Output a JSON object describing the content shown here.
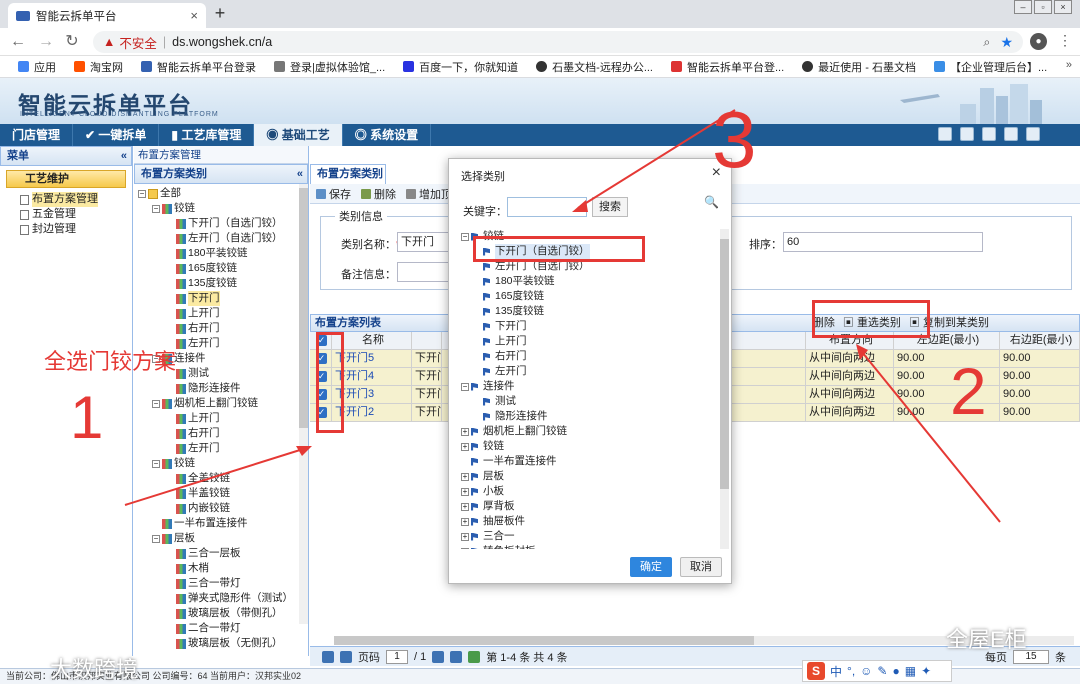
{
  "browser": {
    "tab_title": "智能云拆单平台",
    "tab_close": "×",
    "new_tab": "+",
    "insecure_label": "不安全",
    "url": "ds.wongshek.cn/a",
    "bookmarks": [
      "应用",
      "淘宝网",
      "智能云拆单平台登录",
      "登录|虚拟体验馆_...",
      "百度一下，你就知道",
      "石墨文档-远程办公...",
      "智能云拆单平台登...",
      "最近使用 - 石墨文档",
      "【企业管理后台】..."
    ],
    "bookmark_more": "»"
  },
  "app": {
    "title": "智能云拆单平台",
    "subtitle": "INTELLIGENT CLOUD DISMANTLING PLATFORM",
    "nav": [
      "门店管理",
      "一键拆单",
      "工艺库管理",
      "基础工艺",
      "系统设置"
    ],
    "active_nav": 3
  },
  "leftmenu": {
    "title": "菜单",
    "section": "工艺维护",
    "items": [
      "布置方案管理",
      "五金管理",
      "封边管理"
    ]
  },
  "treepanel": {
    "breadcrumb": "布置方案管理",
    "title": "布置方案类别",
    "nodes": [
      {
        "label": "全部",
        "level": 0,
        "kind": "folder",
        "pm": "−"
      },
      {
        "label": "铰链",
        "level": 1,
        "kind": "bar",
        "pm": "−"
      },
      {
        "label": "下开门（自选门铰）",
        "level": 2,
        "kind": "bar"
      },
      {
        "label": "左开门（自选门铰）",
        "level": 2,
        "kind": "bar"
      },
      {
        "label": "180平装铰链",
        "level": 2,
        "kind": "bar"
      },
      {
        "label": "165度铰链",
        "level": 2,
        "kind": "bar"
      },
      {
        "label": "135度铰链",
        "level": 2,
        "kind": "bar"
      },
      {
        "label": "下开门",
        "level": 2,
        "kind": "bar",
        "hl": true
      },
      {
        "label": "上开门",
        "level": 2,
        "kind": "bar"
      },
      {
        "label": "右开门",
        "level": 2,
        "kind": "bar"
      },
      {
        "label": "左开门",
        "level": 2,
        "kind": "bar"
      },
      {
        "label": "连接件",
        "level": 1,
        "kind": "bar",
        "pm": "−"
      },
      {
        "label": "测试",
        "level": 2,
        "kind": "bar"
      },
      {
        "label": "隐形连接件",
        "level": 2,
        "kind": "bar"
      },
      {
        "label": "烟机柜上翻门铰链",
        "level": 1,
        "kind": "bar",
        "pm": "−"
      },
      {
        "label": "上开门",
        "level": 2,
        "kind": "bar"
      },
      {
        "label": "右开门",
        "level": 2,
        "kind": "bar"
      },
      {
        "label": "左开门",
        "level": 2,
        "kind": "bar"
      },
      {
        "label": "铰链",
        "level": 1,
        "kind": "bar",
        "pm": "−"
      },
      {
        "label": "全盖铰链",
        "level": 2,
        "kind": "bar"
      },
      {
        "label": "半盖铰链",
        "level": 2,
        "kind": "bar"
      },
      {
        "label": "内嵌铰链",
        "level": 2,
        "kind": "bar"
      },
      {
        "label": "一半布置连接件",
        "level": 1,
        "kind": "bar"
      },
      {
        "label": "层板",
        "level": 1,
        "kind": "bar",
        "pm": "−"
      },
      {
        "label": "三合一层板",
        "level": 2,
        "kind": "bar"
      },
      {
        "label": "木梢",
        "level": 2,
        "kind": "bar"
      },
      {
        "label": "三合一带灯",
        "level": 2,
        "kind": "bar"
      },
      {
        "label": "弹夹式隐形件（测试）",
        "level": 2,
        "kind": "bar"
      },
      {
        "label": "玻璃层板（带侧孔）",
        "level": 2,
        "kind": "bar"
      },
      {
        "label": "二合一带灯",
        "level": 2,
        "kind": "bar"
      },
      {
        "label": "玻璃层板（无侧孔）",
        "level": 2,
        "kind": "bar"
      }
    ]
  },
  "main": {
    "tab": "布置方案类别",
    "toolbar": [
      "保存",
      "删除",
      "增加顶级"
    ],
    "fieldset_legend": "类别信息",
    "name_label": "类别名称：",
    "name_required": "*",
    "name_value": "下开门",
    "remark_label": "备注信息：",
    "sort_label": "排序：",
    "sort_value": "60",
    "grid_title": "布置方案列表",
    "grid_tools": [
      "删除",
      "重选类别",
      "复制到某类别"
    ],
    "columns_left": [
      "名称"
    ],
    "columns_right": [
      "布置方向",
      "左边距(最小)",
      "右边距(最小)"
    ],
    "rows": [
      {
        "name": "下开门5",
        "name2": "下开门",
        "dir": "从中间向两边",
        "l": "90.00",
        "r": "90.00"
      },
      {
        "name": "下开门4",
        "name2": "下开门",
        "dir": "从中间向两边",
        "l": "90.00",
        "r": "90.00"
      },
      {
        "name": "下开门3",
        "name2": "下开门",
        "dir": "从中间向两边",
        "l": "90.00",
        "r": "90.00"
      },
      {
        "name": "下开门2",
        "name2": "下开门",
        "dir": "从中间向两边",
        "l": "90.00",
        "r": "90.00"
      }
    ]
  },
  "pager": {
    "page_label": "页码",
    "page": "1",
    "total_pages": "/ 1",
    "summary": "第 1-4 条  共 4 条",
    "per_page_label": "每页",
    "per_page": "15",
    "unit": "条"
  },
  "statusbar": "当前公司：佛山市汉邦实业有限公司    公司编号：64    当前用户：汉邦实业02",
  "modal": {
    "title": "选择类别",
    "close": "×",
    "keyword_label": "关键字：",
    "search_button": "搜索",
    "nodes": [
      {
        "label": "铰链",
        "level": 0,
        "pm": "−"
      },
      {
        "label": "下开门（自选门铰）",
        "level": 1,
        "sel": true
      },
      {
        "label": "左开门（自选门铰）",
        "level": 1
      },
      {
        "label": "180平装铰链",
        "level": 1
      },
      {
        "label": "165度铰链",
        "level": 1
      },
      {
        "label": "135度铰链",
        "level": 1
      },
      {
        "label": "下开门",
        "level": 1
      },
      {
        "label": "上开门",
        "level": 1
      },
      {
        "label": "右开门",
        "level": 1
      },
      {
        "label": "左开门",
        "level": 1
      },
      {
        "label": "连接件",
        "level": 0,
        "pm": "−"
      },
      {
        "label": "测试",
        "level": 1
      },
      {
        "label": "隐形连接件",
        "level": 1
      },
      {
        "label": "烟机柜上翻门铰链",
        "level": 0,
        "pm": "+"
      },
      {
        "label": "铰链",
        "level": 0,
        "pm": "+"
      },
      {
        "label": "一半布置连接件",
        "level": 0
      },
      {
        "label": "层板",
        "level": 0,
        "pm": "+"
      },
      {
        "label": "小板",
        "level": 0,
        "pm": "+"
      },
      {
        "label": "厚背板",
        "level": 0,
        "pm": "+"
      },
      {
        "label": "抽屉板件",
        "level": 0,
        "pm": "+"
      },
      {
        "label": "三合一",
        "level": 0,
        "pm": "+"
      },
      {
        "label": "转角板封板",
        "level": 0,
        "pm": "+"
      }
    ],
    "ok": "确定",
    "cancel": "取消"
  },
  "annotations": {
    "text1": "全选门铰方案",
    "num1": "1",
    "num2": "2",
    "num3": "3"
  },
  "ime": {
    "logo": "S",
    "lang": "中"
  },
  "watermarks": {
    "left": "大数跨境",
    "right": "全屋E柜"
  },
  "colors": {
    "accent": "#1e5a92",
    "annotation": "#e53935",
    "row_highlight": "#f5f1cf"
  }
}
